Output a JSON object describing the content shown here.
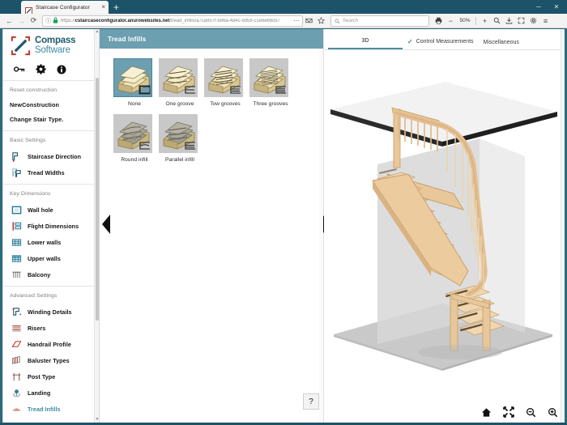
{
  "browser": {
    "tab": {
      "title": "Staircase Configurator",
      "close_label": "×",
      "favicon": "compass-logo-icon"
    },
    "new_tab_label": "+",
    "window_controls": [
      {
        "name": "minimize-button",
        "glyph": "─"
      },
      {
        "name": "maximize-button",
        "glyph": "✕"
      }
    ],
    "nav": {
      "back_label": "←",
      "forward_label": "→",
      "reload_label": "⟳",
      "info_label": "ⓘ",
      "lock_label": "🔒"
    },
    "url": {
      "scheme": "https://",
      "host": "cstaircaseconfigurator.anurowebsites.net",
      "path": "/tread_infills/a7ca937f-b96a-4d4c-9d59-c1e6e68cb7",
      "menu_label": "⋯"
    },
    "search": {
      "placeholder": "Search",
      "icon": "search-icon"
    },
    "toolbar": {
      "print_label": "⎙",
      "zoom_out_label": "−",
      "zoom_level": "50%",
      "zoom_in_label": "+",
      "find_label": "search-icon",
      "save_label": "save-icon",
      "fullscreen_label": "expand-icon",
      "settings_label": "gear-icon",
      "menu_label": "≡"
    }
  },
  "sidebar": {
    "brand": {
      "line1": "Compass",
      "line2": "Software",
      "logo": "compass-logo-icon"
    },
    "tool_icons": [
      {
        "name": "key-icon",
        "label": "key"
      },
      {
        "name": "gear-icon",
        "label": "settings"
      },
      {
        "name": "info-icon",
        "label": "info"
      }
    ],
    "links": [
      {
        "label": "Reset construction",
        "style": "muted"
      },
      {
        "label": "NewConstruction",
        "style": "bold"
      },
      {
        "label": "Change Stair Type.",
        "style": "bold"
      }
    ],
    "groups": [
      {
        "title": "Basic Settings",
        "items": [
          {
            "label": "Staircase Direction",
            "icon": "staircase-direction-icon",
            "active": false
          },
          {
            "label": "Tread Widths",
            "icon": "tread-widths-icon",
            "active": false
          }
        ]
      },
      {
        "title": "Key Dimensions",
        "items": [
          {
            "label": "Wall hole",
            "icon": "wall-hole-icon",
            "active": false
          },
          {
            "label": "Flight Dimensions",
            "icon": "flight-dimensions-icon",
            "active": false
          },
          {
            "label": "Lower walls",
            "icon": "lower-walls-icon",
            "active": false
          },
          {
            "label": "Upper walls",
            "icon": "upper-walls-icon",
            "active": false
          },
          {
            "label": "Balcony",
            "icon": "balcony-icon",
            "active": false
          }
        ]
      },
      {
        "title": "Advanced Settings",
        "items": [
          {
            "label": "Winding Details",
            "icon": "winding-details-icon",
            "active": false
          },
          {
            "label": "Risers",
            "icon": "risers-icon",
            "active": false
          },
          {
            "label": "Handrail Profile",
            "icon": "handrail-profile-icon",
            "active": false
          },
          {
            "label": "Baluster Types",
            "icon": "baluster-types-icon",
            "active": false
          },
          {
            "label": "Post Type",
            "icon": "post-type-icon",
            "active": false
          },
          {
            "label": "Landing",
            "icon": "landing-icon",
            "active": false
          },
          {
            "label": "Tread Infills",
            "icon": "tread-infills-icon",
            "active": true
          }
        ]
      }
    ]
  },
  "panel": {
    "title": "Tread Infills",
    "options": [
      {
        "label": "None",
        "selected": true,
        "grooves": 0,
        "style": "plain"
      },
      {
        "label": "One groove",
        "selected": false,
        "grooves": 1,
        "style": "plain"
      },
      {
        "label": "Tow grooves",
        "selected": false,
        "grooves": 2,
        "style": "plain"
      },
      {
        "label": "Three grooves",
        "selected": false,
        "grooves": 3,
        "style": "plain"
      },
      {
        "label": "Round infill",
        "selected": false,
        "grooves": 3,
        "style": "round"
      },
      {
        "label": "Parallel infill",
        "selected": false,
        "grooves": 3,
        "style": "parallel"
      }
    ],
    "prev_label": "◀",
    "next_label": "▶",
    "help_label": "?"
  },
  "viewer": {
    "tabs": [
      {
        "label": "3D",
        "active": true,
        "check": false
      },
      {
        "label": "Control Measurements",
        "active": false,
        "check": true
      },
      {
        "label": "Miscellaneous",
        "active": false,
        "check": false
      }
    ],
    "check_glyph": "✓",
    "tools": [
      {
        "name": "home-icon",
        "label": "home"
      },
      {
        "name": "fit-to-screen-icon",
        "label": "fit"
      },
      {
        "name": "zoom-out-icon",
        "label": "zoom out"
      },
      {
        "name": "zoom-in-icon",
        "label": "zoom in"
      }
    ],
    "scene": "3d-staircase-render"
  },
  "colors": {
    "brand_dark": "#1f5a6e",
    "brand_light": "#3d8ba3",
    "panel_header": "#6c9fb0",
    "titlebar": "#1d5369",
    "thumb_bg": "#c8c8c8",
    "wood": "#e8c79a"
  }
}
